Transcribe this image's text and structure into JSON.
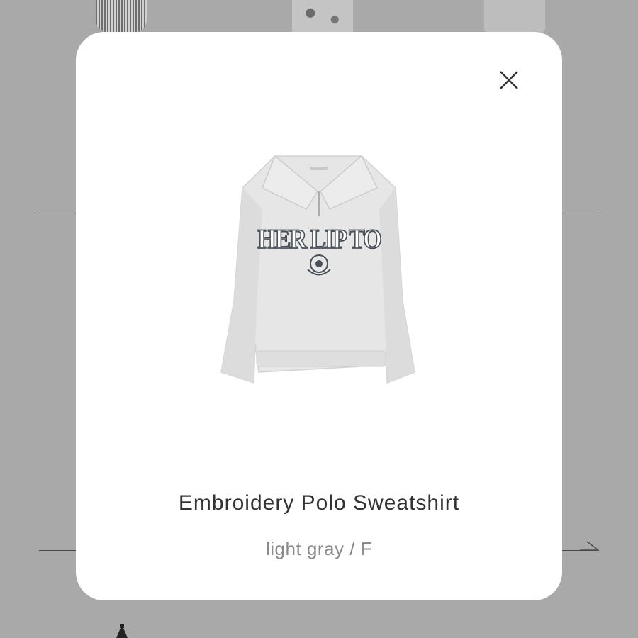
{
  "product": {
    "name": "Embroidery Polo Sweatshirt",
    "variant": "light gray / F",
    "image_icon": "sweatshirt-image",
    "print_text": "HER LIP TO"
  },
  "modal": {
    "close_icon": "close-icon"
  },
  "colors": {
    "backdrop": "#a9a9a9",
    "modal": "#ffffff",
    "title": "#333333",
    "subtitle": "#8a8a8a",
    "garment": "#e6e6e6",
    "print": "#4a5058"
  }
}
